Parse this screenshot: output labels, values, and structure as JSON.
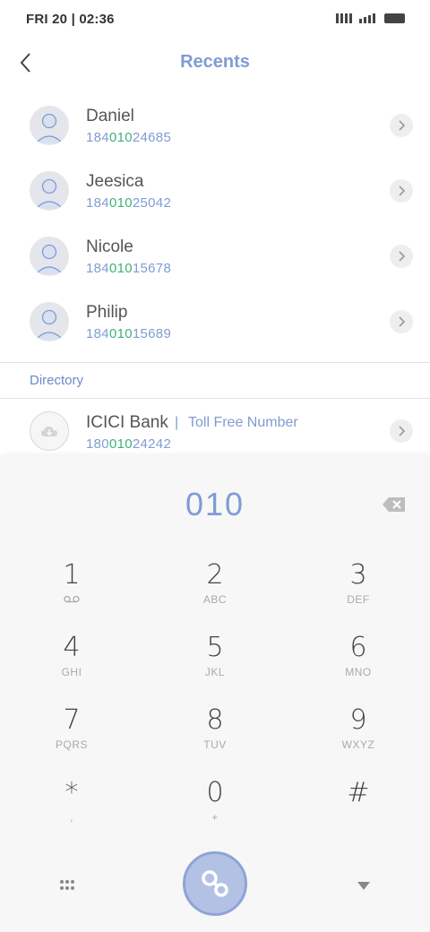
{
  "status_bar": {
    "time": "FRI 20 | 02:36"
  },
  "header": {
    "title": "Recents"
  },
  "recents": [
    {
      "name": "Daniel",
      "number_pre": "184",
      "number_match": "010",
      "number_post": "24685"
    },
    {
      "name": "Jeesica",
      "number_pre": "184",
      "number_match": "010",
      "number_post": "25042"
    },
    {
      "name": "Nicole",
      "number_pre": "184",
      "number_match": "010",
      "number_post": "15678"
    },
    {
      "name": "Philip",
      "number_pre": "184",
      "number_match": "010",
      "number_post": "15689"
    }
  ],
  "directory": {
    "label": "Directory",
    "entry": {
      "name": "ICICI Bank",
      "separator": "|",
      "tag": "Toll Free Number",
      "number_pre": "180",
      "number_match": "010",
      "number_post": "24242"
    }
  },
  "dialpad": {
    "input": "010",
    "keys": [
      {
        "digit": "1",
        "letters": ""
      },
      {
        "digit": "2",
        "letters": "ABC"
      },
      {
        "digit": "3",
        "letters": "DEF"
      },
      {
        "digit": "4",
        "letters": "GHI"
      },
      {
        "digit": "5",
        "letters": "JKL"
      },
      {
        "digit": "6",
        "letters": "MNO"
      },
      {
        "digit": "7",
        "letters": "PQRS"
      },
      {
        "digit": "8",
        "letters": "TUV"
      },
      {
        "digit": "9",
        "letters": "WXYZ"
      },
      {
        "digit": "*",
        "letters": ","
      },
      {
        "digit": "0",
        "letters": "+"
      },
      {
        "digit": "#",
        "letters": ""
      }
    ]
  },
  "icons": {
    "back": "chevron-left-icon",
    "row_action": "chevron-right-icon",
    "voicemail": "voicemail-icon",
    "backspace": "backspace-icon",
    "grid": "grid-icon",
    "call": "call-icon",
    "collapse": "triangle-down-icon"
  },
  "colors": {
    "accent": "#7f9cd3",
    "match": "#3db27a",
    "call_button": "#b3c2e4"
  }
}
